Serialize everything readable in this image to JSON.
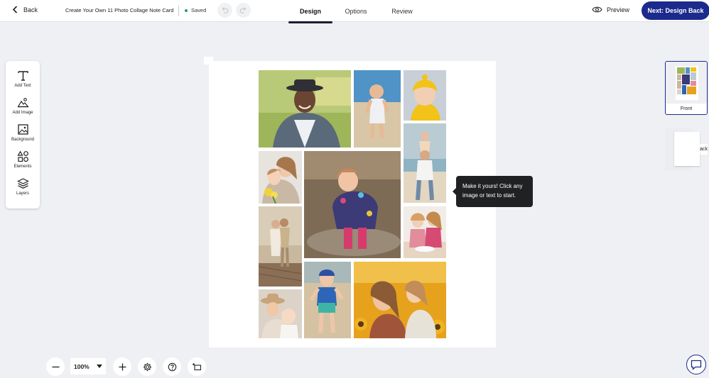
{
  "header": {
    "back_label": "Back",
    "document_title": "Create Your Own 11 Photo Collage Note Card",
    "save_status": "Saved",
    "tabs": [
      {
        "label": "Design",
        "active": true
      },
      {
        "label": "Options",
        "active": false
      },
      {
        "label": "Review",
        "active": false
      }
    ],
    "preview_label": "Preview",
    "next_button_label": "Next: Design Back"
  },
  "toolbar": {
    "tools": [
      {
        "label": "Add Text",
        "icon": "text-icon"
      },
      {
        "label": "Add Image",
        "icon": "image-add-icon"
      },
      {
        "label": "Background",
        "icon": "background-icon"
      },
      {
        "label": "Elements",
        "icon": "shapes-icon"
      },
      {
        "label": "Layers",
        "icon": "layers-icon"
      }
    ]
  },
  "canvas": {
    "tooltip": "Make it yours! Click any image or text to start.",
    "photos": [
      {
        "name": "photo-smiling-man-hat"
      },
      {
        "name": "photo-toddler-beach-walking"
      },
      {
        "name": "photo-baby-yellow-hat"
      },
      {
        "name": "photo-mother-daughter-flowers"
      },
      {
        "name": "photo-child-puddle-boots"
      },
      {
        "name": "photo-father-child-shoulders-beach"
      },
      {
        "name": "photo-couple-lake-dock"
      },
      {
        "name": "photo-girls-baking"
      },
      {
        "name": "photo-mother-baby-sunhat"
      },
      {
        "name": "photo-boy-swimsuit-beach"
      },
      {
        "name": "photo-mother-daughter-sunflowers"
      }
    ]
  },
  "pages": [
    {
      "label": "Front",
      "selected": true
    },
    {
      "label": "Back",
      "selected": false
    }
  ],
  "zoom": {
    "value": "100%"
  },
  "colors": {
    "accent": "#1b2a8c",
    "tooltip_bg": "#1f2123",
    "saved_dot": "#2e9e57",
    "canvas_bg": "#eef0f3"
  }
}
